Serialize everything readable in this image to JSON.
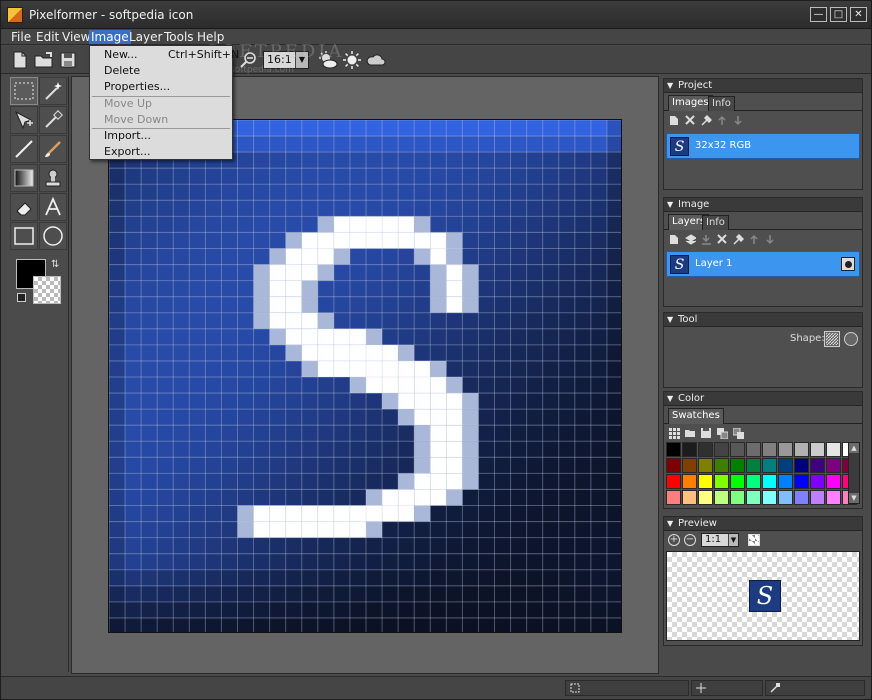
{
  "window": {
    "title": "Pixelformer - softpedia icon"
  },
  "menubar": {
    "items": [
      "File",
      "Edit",
      "View",
      "Image",
      "Layer",
      "Tools",
      "Help"
    ],
    "active": "Image"
  },
  "toolbar": {
    "zoom_value": "16:1"
  },
  "watermark": {
    "line1": "SOFTPEDIA",
    "line2": "www.softpedia.com"
  },
  "image_menu": {
    "new_label": "New...",
    "new_shortcut": "Ctrl+Shift+N",
    "delete_label": "Delete",
    "properties_label": "Properties...",
    "move_up_label": "Move Up",
    "move_down_label": "Move Down",
    "import_label": "Import...",
    "export_label": "Export..."
  },
  "panels": {
    "project": {
      "title": "Project",
      "tabs": [
        "Images",
        "Info"
      ],
      "active_tab": "Images",
      "items": [
        {
          "label": "32x32 RGB"
        }
      ]
    },
    "image": {
      "title": "Image",
      "tabs": [
        "Layers",
        "Info"
      ],
      "active_tab": "Layers",
      "layers": [
        {
          "label": "Layer 1"
        }
      ]
    },
    "tool": {
      "title": "Tool",
      "shape_label": "Shape:"
    },
    "color": {
      "title": "Color",
      "tabs": [
        "Swatches"
      ],
      "swatches": [
        "#000000",
        "#1c1c1c",
        "#303030",
        "#444444",
        "#585858",
        "#6c6c6c",
        "#808080",
        "#999999",
        "#b2b2b2",
        "#cbcbcb",
        "#e5e5e5",
        "#ffffff",
        "#7f0000",
        "#7f3f00",
        "#7f7f00",
        "#3f7f00",
        "#007f00",
        "#007f3f",
        "#007f7f",
        "#003f7f",
        "#00007f",
        "#3f007f",
        "#7f007f",
        "#7f003f",
        "#ff0000",
        "#ff7f00",
        "#ffff00",
        "#7fff00",
        "#00ff00",
        "#00ff7f",
        "#00ffff",
        "#007fff",
        "#0000ff",
        "#7f00ff",
        "#ff00ff",
        "#ff007f",
        "#ff7f7f",
        "#ffbf7f",
        "#ffff7f",
        "#bfff7f",
        "#7fff7f",
        "#7fffbf",
        "#7fffff",
        "#7fbfff",
        "#7f7fff",
        "#bf7fff",
        "#ff7fff",
        "#ff7fbf"
      ]
    },
    "preview": {
      "title": "Preview",
      "zoom_value": "1:1"
    }
  },
  "canvas": {
    "glyph": "S",
    "grid_size": 32,
    "background": "#1d3b7d",
    "glyph_color": "#ffffff"
  }
}
